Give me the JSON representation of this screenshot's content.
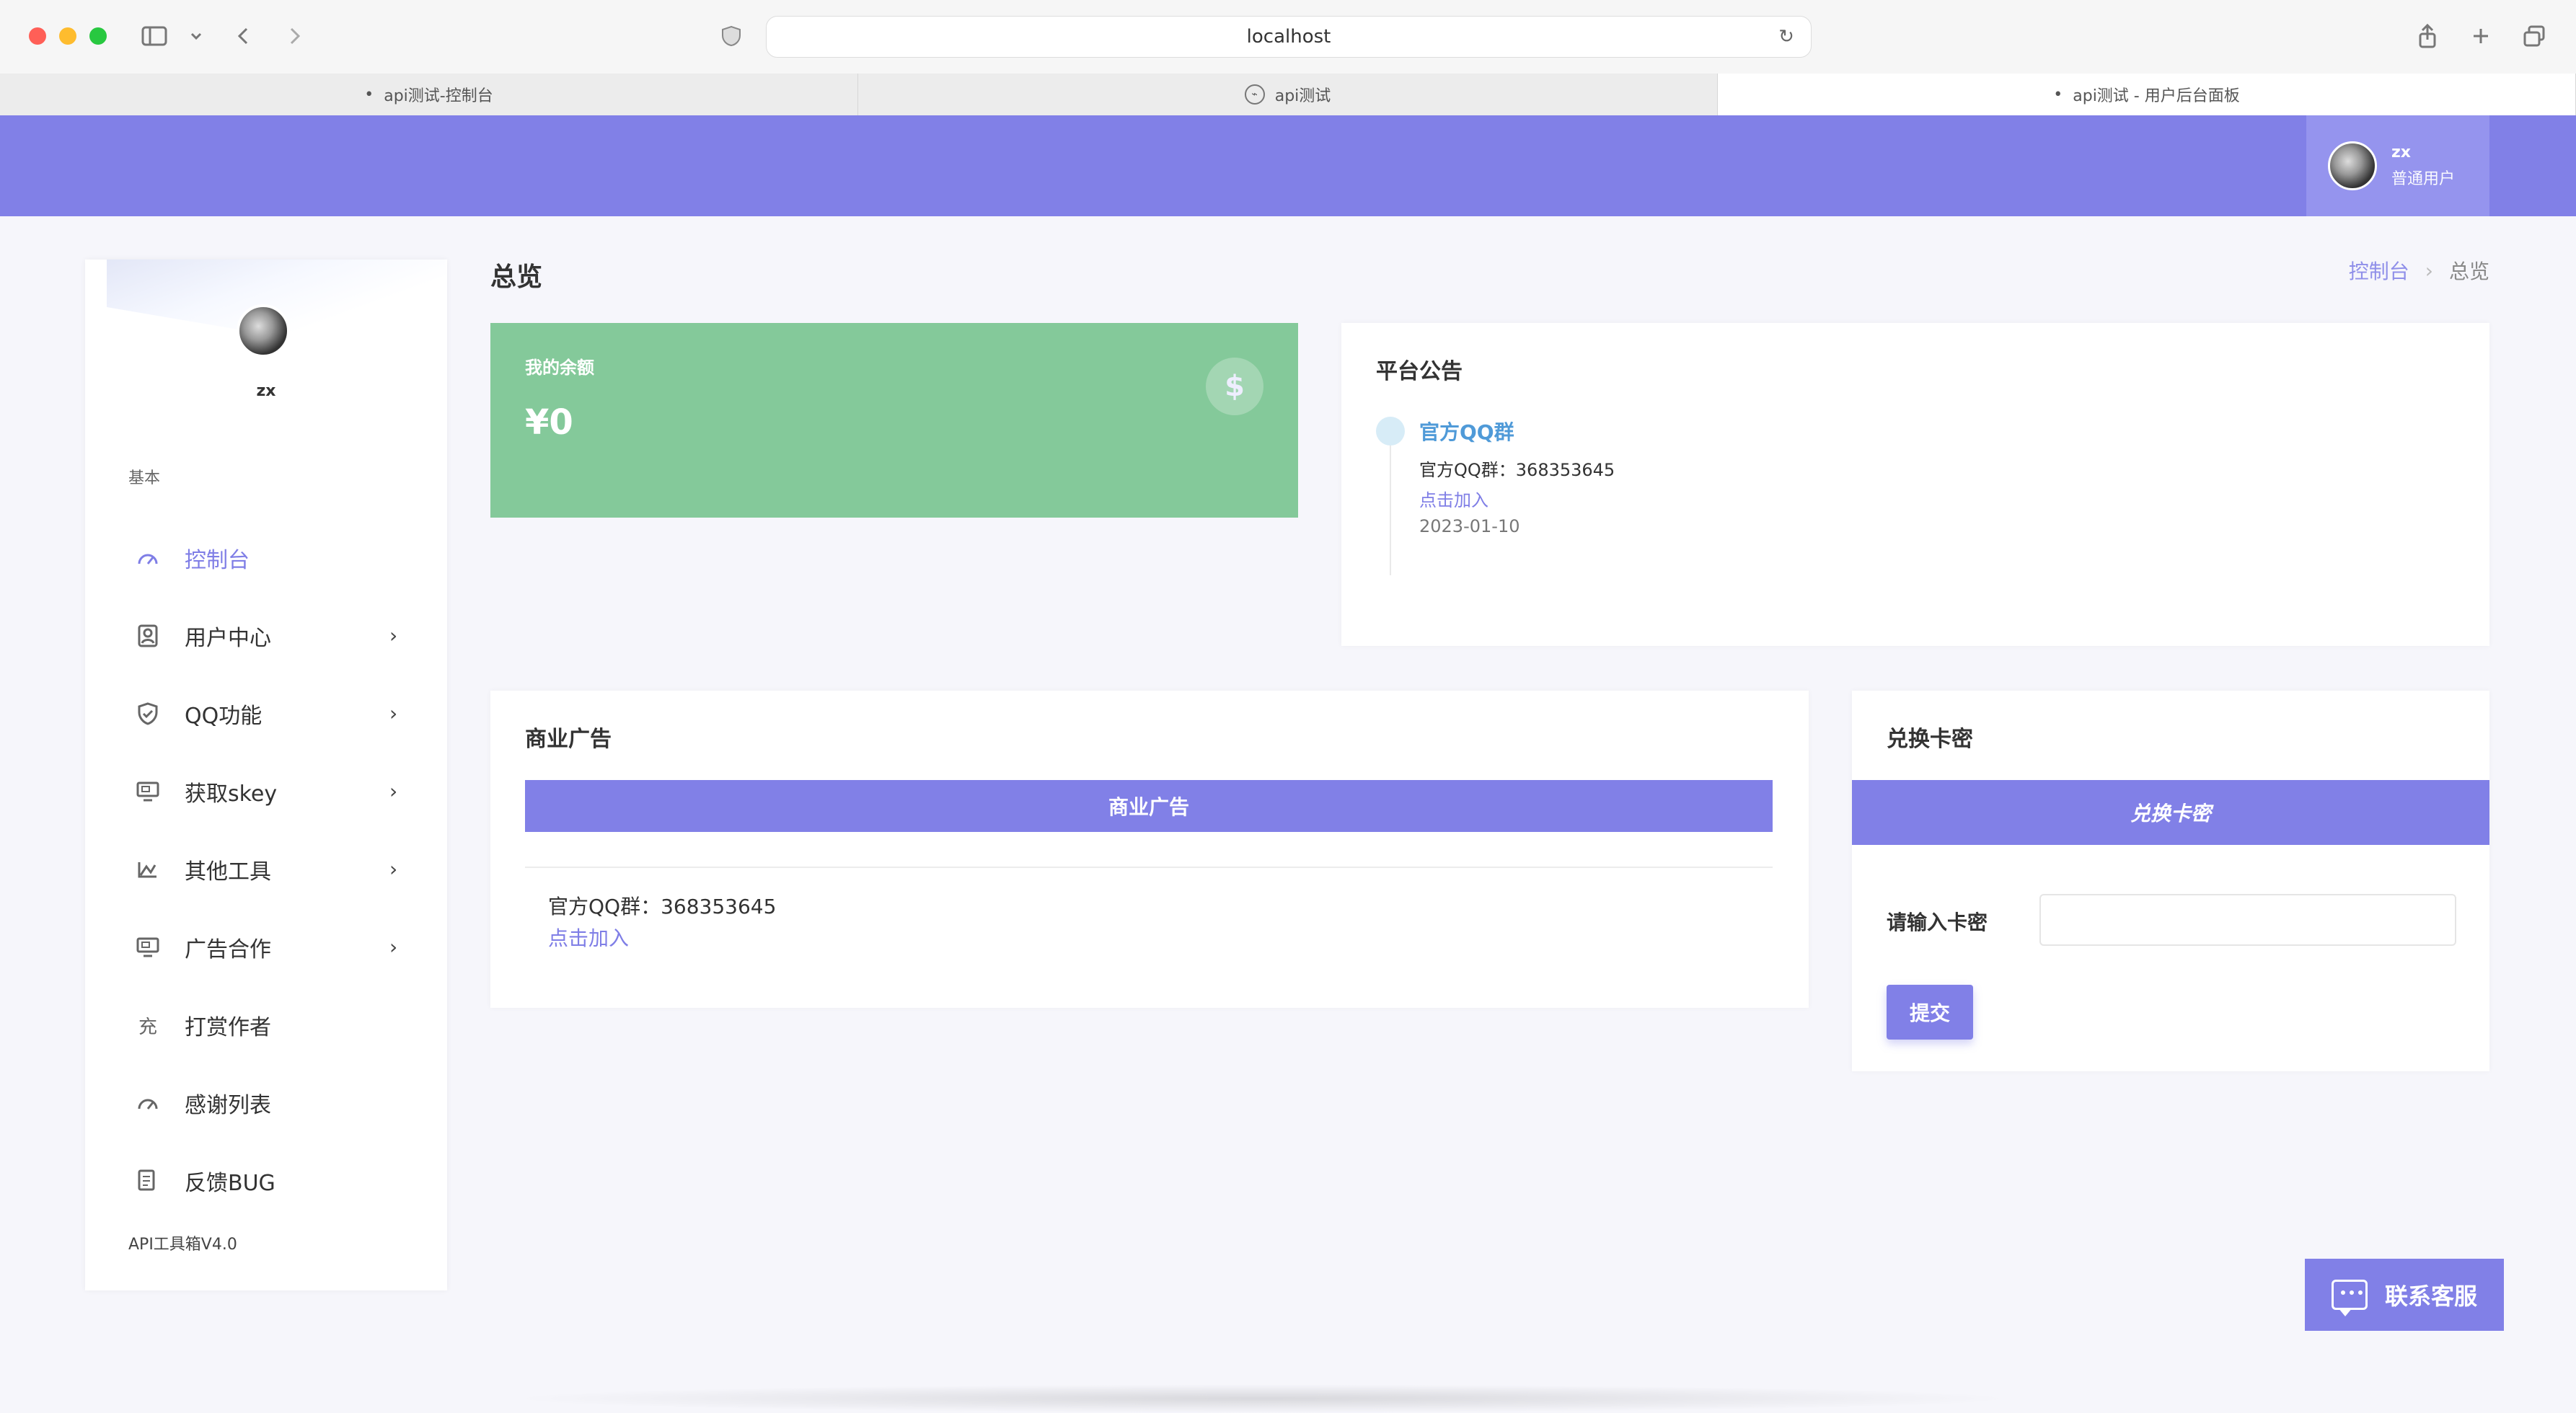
{
  "browser": {
    "address": "localhost",
    "tabs": [
      {
        "label": "api测试-控制台"
      },
      {
        "label": "api测试"
      },
      {
        "label": "api测试 - 用户后台面板"
      }
    ]
  },
  "appbar": {
    "user": {
      "name": "zx",
      "role": "普通用户"
    }
  },
  "sidebar": {
    "user_name": "zx",
    "section_title": "基本",
    "items": [
      {
        "label": "控制台",
        "icon": "dashboard-icon",
        "active": true
      },
      {
        "label": "用户中心",
        "icon": "user-card-icon",
        "has_children": true
      },
      {
        "label": "QQ功能",
        "icon": "shield-icon",
        "has_children": true
      },
      {
        "label": "获取skey",
        "icon": "monitor-ad-icon",
        "has_children": true
      },
      {
        "label": "其他工具",
        "icon": "chart-icon",
        "has_children": true
      },
      {
        "label": "广告合作",
        "icon": "monitor-ad-icon",
        "has_children": true
      },
      {
        "label": "打赏作者",
        "icon": "recharge-icon"
      },
      {
        "label": "感谢列表",
        "icon": "dashboard-icon"
      },
      {
        "label": "反馈BUG",
        "icon": "feedback-icon"
      }
    ],
    "footer": "API工具箱V4.0"
  },
  "page": {
    "title": "总览",
    "breadcrumb": {
      "parent": "控制台",
      "current": "总览"
    }
  },
  "balance": {
    "title": "我的余额",
    "amount": "¥0"
  },
  "notice": {
    "title": "平台公告",
    "entries": [
      {
        "title": "官方QQ群",
        "desc": "官方QQ群：368353645",
        "link": "点击加入",
        "date": "2023-01-10"
      }
    ]
  },
  "ads": {
    "title": "商业广告",
    "bar": "商业广告",
    "desc": "官方QQ群：368353645",
    "link": "点击加入"
  },
  "redeem": {
    "title": "兑换卡密",
    "banner": "兑换卡密",
    "label": "请输入卡密",
    "input_value": "",
    "input_placeholder": "",
    "submit": "提交"
  },
  "support": {
    "label": "联系客服"
  }
}
